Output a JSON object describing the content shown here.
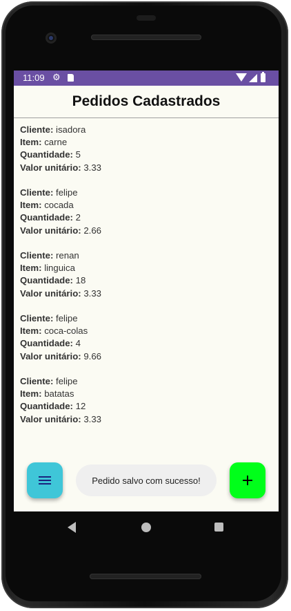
{
  "status_bar": {
    "time": "11:09",
    "settings_icon": "gear-icon",
    "sd_icon": "sd-card-icon",
    "wifi_icon": "wifi-icon",
    "signal_icon": "signal-icon",
    "battery_icon": "battery-icon"
  },
  "header": {
    "title": "Pedidos Cadastrados"
  },
  "labels": {
    "cliente": "Cliente:",
    "item": "Item:",
    "quantidade": "Quantidade:",
    "valor": "Valor unitário:"
  },
  "orders": [
    {
      "cliente": "isadora",
      "item": "carne",
      "quantidade": "5",
      "valor": "3.33"
    },
    {
      "cliente": "felipe",
      "item": "cocada",
      "quantidade": "2",
      "valor": "2.66"
    },
    {
      "cliente": "renan",
      "item": "linguica",
      "quantidade": "18",
      "valor": "3.33"
    },
    {
      "cliente": "felipe",
      "item": "coca-colas",
      "quantidade": "4",
      "valor": "9.66"
    },
    {
      "cliente": "felipe",
      "item": "batatas",
      "quantidade": "12",
      "valor": "3.33"
    }
  ],
  "snackbar": {
    "message": "Pedido salvo com sucesso!"
  },
  "fabs": {
    "menu_icon": "menu-icon",
    "add_icon": "plus-icon"
  },
  "colors": {
    "status_bar": "#6a4fa3",
    "screen_bg": "#fbfbf3",
    "menu_fab": "#3fc6d8",
    "add_fab": "#00ff1a"
  },
  "nav": {
    "back_icon": "back-triangle-icon",
    "home_icon": "home-circle-icon",
    "recents_icon": "recents-square-icon"
  }
}
